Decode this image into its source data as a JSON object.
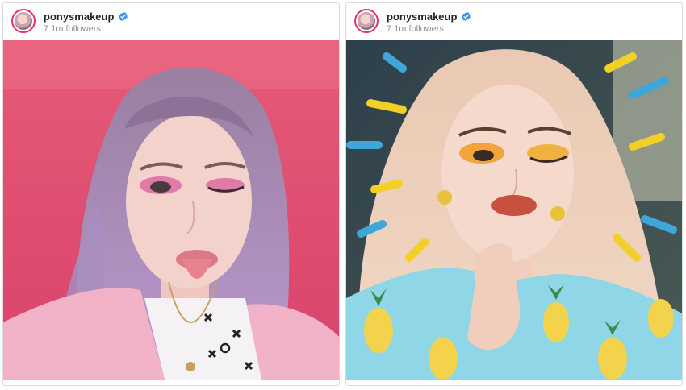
{
  "posts": [
    {
      "username": "ponysmakeup",
      "followers": "7.1m followers",
      "verified": true,
      "avatar_icon": "profile-avatar",
      "photo": "selfie-pink-background-purple-hair"
    },
    {
      "username": "ponysmakeup",
      "followers": "7.1m followers",
      "verified": true,
      "avatar_icon": "profile-avatar",
      "photo": "selfie-yellow-eyeshadow-pineapple-shirt"
    }
  ],
  "colors": {
    "verified_badge": "#3897f0",
    "story_ring": "#e1306c",
    "username": "#262626",
    "followers": "#8e8e8e"
  }
}
